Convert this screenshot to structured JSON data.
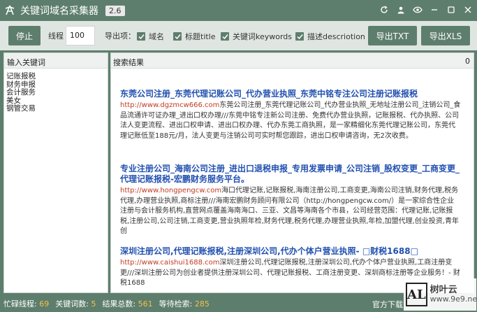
{
  "window": {
    "title": "关键词域名采集器",
    "version": "2.6"
  },
  "toolbar": {
    "stop_label": "停止",
    "thread_label": "线程",
    "thread_value": "100",
    "export_label": "导出项：",
    "checkboxes": [
      {
        "label": "域名",
        "checked": true
      },
      {
        "label": "标题title",
        "checked": true
      },
      {
        "label": "关键词keywords",
        "checked": true
      },
      {
        "label": "描述descriotion",
        "checked": true
      }
    ],
    "export_txt_label": "导出TXT",
    "export_xls_label": "导出XLS"
  },
  "left_panel": {
    "header": "输入关键词",
    "keywords": [
      "记账报税",
      "财务申报",
      "会计服务",
      "美女",
      "钢管交易"
    ]
  },
  "right_panel": {
    "header": "搜索结果",
    "count": "0",
    "results": [
      {
        "title": "东莞公司注册_东莞代理记账公司_代办营业执照_东莞中铭专注公司注册记账报税",
        "url": "http://www.dgzmcw666.com",
        "desc": "东莞公司注册_东莞代理记账公司_代办营业执照_无地址注册公司_注销公司_食品流通许可证办理_进出口权办理///东莞中铭专注新公司注册、免费代办营业执照，记账报税、代办执照、公司法人变更流程、进出口权申请、进出口权办理、代办东莞工商执照，是一家精细化东莞代理记账公司，东莞代理记账低至188元/月，法人变更与注销公司可实时帮您跟踪，进出口权申请咨询，无2次收费。"
      },
      {
        "title": "专业注册公司_海南公司注册_进出口退税申报_专用发票申请_公司注销_股权变更_工商变更_代理记账报税-宏鹏财务服务平台。",
        "url": "http://www.hongpengcw.com",
        "desc": "海口代理记账,记账报税,海南注册公司,工商变更,海南公司注销,财务代理,税务代理,办理营业执照,商标注册///海南宏鹏财务顾问有限公司（http://hongpengcw.com/）是一家综合性企业注册与会计服务机构,直营网点覆盖海南海口、三亚、文昌等海南各个市县，公司经营范围：代理记账,记账报税,注册公司,公司注销,工商变更,营业执照年检,财务代理,税务代理,办理营业执照,年检,加盟代理,创业投资,青年创"
      },
      {
        "title": "深圳注册公司,代理记账报税,注册深圳公司,代办个体户营业执照- □财税1688□",
        "url": "http://www.caishui1688.com",
        "desc": "深圳注册公司,代理记账报税,注册深圳公司,代办个体户营业执照,工商注册变更///深圳注册公司为创业者提供注册深圳公司、代理记账报税、工商注册变更、深圳商标注册等企业服务！- 财税1688"
      }
    ]
  },
  "status": {
    "busy_threads_label": "忙碌线程:",
    "busy_threads": "69",
    "keywords_label": "关键词数:",
    "keywords": "5",
    "results_label": "结果总数:",
    "results": "561",
    "waiting_label": "等待检索:",
    "waiting": "285",
    "official_download": "官方下载"
  },
  "watermark": {
    "logo": "AL",
    "name": "树叶云",
    "site": "www.9e9.net"
  },
  "colors": {
    "primary": "#5e7e6d",
    "link": "#2150b0",
    "url": "#c23b22",
    "status_value": "#f5c04a"
  }
}
